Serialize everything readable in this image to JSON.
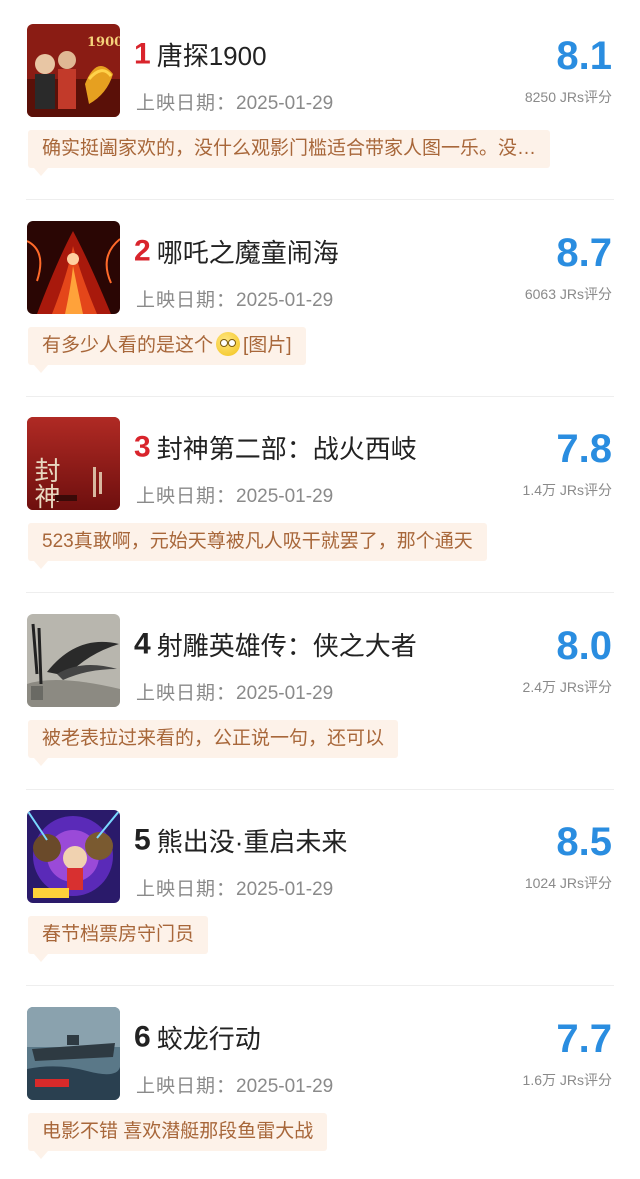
{
  "date_label": "上映日期：",
  "accent_colors": {
    "rank_top": "#d9242c",
    "score": "#2a8de0",
    "comment_text": "#a8673a",
    "comment_bg": "#fdf2e9"
  },
  "movies": [
    {
      "rank": "1",
      "title": "唐探1900",
      "date": "2025-01-29",
      "score": "8.1",
      "ratings": "8250 JRs评分",
      "comment": "确实挺阖家欢的，没什么观影门槛适合带家人图一乐。没…",
      "comment_suffix": "",
      "poster_text": "1900"
    },
    {
      "rank": "2",
      "title": "哪吒之魔童闹海",
      "date": "2025-01-29",
      "score": "8.7",
      "ratings": "6063 JRs评分",
      "comment": "有多少人看的是这个",
      "comment_suffix": "[图片]",
      "has_emoji": true,
      "poster_text": ""
    },
    {
      "rank": "3",
      "title": "封神第二部：战火西岐",
      "date": "2025-01-29",
      "score": "7.8",
      "ratings": "1.4万 JRs评分",
      "comment": "523真敢啊，元始天尊被凡人吸干就罢了，那个通天",
      "comment_suffix": "",
      "poster_text": "封神"
    },
    {
      "rank": "4",
      "title": "射雕英雄传：侠之大者",
      "date": "2025-01-29",
      "score": "8.0",
      "ratings": "2.4万 JRs评分",
      "comment": "被老表拉过来看的，公正说一句，还可以",
      "comment_suffix": "",
      "poster_text": ""
    },
    {
      "rank": "5",
      "title": "熊出没·重启未来",
      "date": "2025-01-29",
      "score": "8.5",
      "ratings": "1024 JRs评分",
      "comment": "春节档票房守门员",
      "comment_suffix": "",
      "poster_text": ""
    },
    {
      "rank": "6",
      "title": "蛟龙行动",
      "date": "2025-01-29",
      "score": "7.7",
      "ratings": "1.6万 JRs评分",
      "comment": "电影不错 喜欢潜艇那段鱼雷大战",
      "comment_suffix": "",
      "poster_text": ""
    }
  ]
}
